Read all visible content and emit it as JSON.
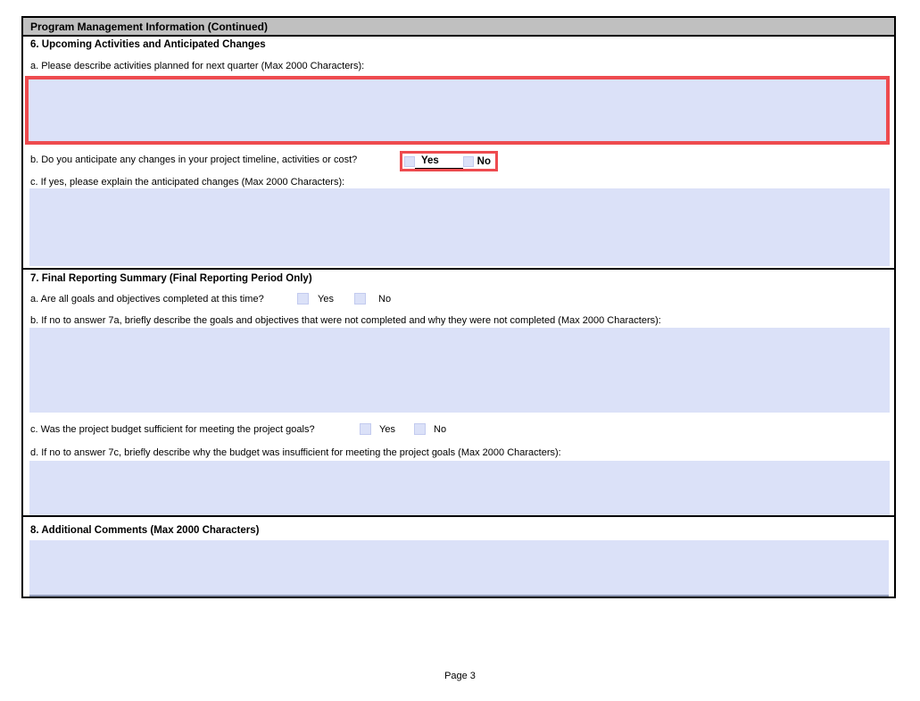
{
  "header": {
    "title": "Program Management Information (Continued)"
  },
  "colors": {
    "header_bg": "#c0c0c0",
    "field_bg": "#dbe1f8",
    "highlight_red": "#ee4b4f"
  },
  "section6": {
    "title": "6. Upcoming Activities and Anticipated Changes",
    "qa_label": "a. Please describe activities planned for next quarter (Max 2000 Characters):",
    "qa_value": "",
    "qb_label": "b. Do you anticipate any changes in your project timeline, activities or cost?",
    "qb_yes": "Yes",
    "qb_no": "No",
    "qc_label": "c. If yes, please explain the anticipated changes (Max 2000 Characters):",
    "qc_value": ""
  },
  "section7": {
    "title": "7. Final Reporting Summary (Final Reporting Period Only)",
    "qa_label": "a. Are all goals and objectives completed at this time?",
    "qa_yes": "Yes",
    "qa_no": "No",
    "qb_label": "b. If no to answer 7a, briefly describe the goals and objectives that were not completed and why they were not completed (Max 2000 Characters):",
    "qb_value": "",
    "qc_label": "c. Was the project budget sufficient for meeting the project goals?",
    "qc_yes": "Yes",
    "qc_no": "No",
    "qd_label": "d. If no to answer 7c, briefly describe why the budget was insufficient for meeting the project goals (Max 2000 Characters):",
    "qd_value": ""
  },
  "section8": {
    "title": "8. Additional Comments (Max 2000 Characters)",
    "value": ""
  },
  "footer": {
    "page_label": "Page 3"
  }
}
